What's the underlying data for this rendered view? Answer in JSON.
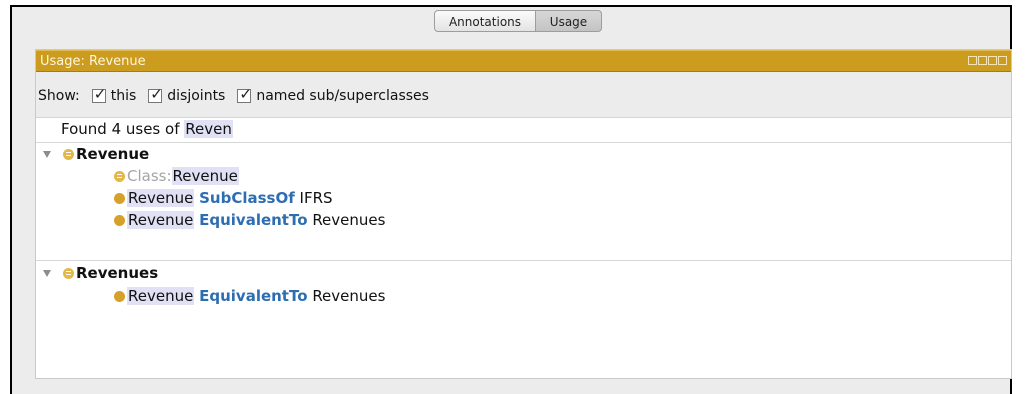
{
  "tabs": [
    "Annotations",
    "Usage"
  ],
  "panel": {
    "title": "Usage: Revenue"
  },
  "show": {
    "label": "Show:",
    "options": [
      {
        "label": "this",
        "checked": true
      },
      {
        "label": "disjoints",
        "checked": true
      },
      {
        "label": "named sub/superclasses",
        "checked": true
      }
    ]
  },
  "found": {
    "prefix": "Found 4 uses of",
    "term": "Reven"
  },
  "groups": [
    {
      "name": "Revenue",
      "items": [
        {
          "label": "Class:",
          "rest": "Revenue"
        },
        {
          "subject": "Revenue",
          "keyword": "SubClassOf",
          "object": "IFRS"
        },
        {
          "subject": "Revenue",
          "keyword": "EquivalentTo",
          "object": "Revenues"
        }
      ]
    },
    {
      "name": "Revenues",
      "items": [
        {
          "subject": "Revenue",
          "keyword": "EquivalentTo",
          "object": "Revenues"
        }
      ]
    }
  ],
  "colors": {
    "titlebar": "#cc9c1e",
    "keyword": "#2d6eb2",
    "highlight": "#e1e1f5"
  }
}
